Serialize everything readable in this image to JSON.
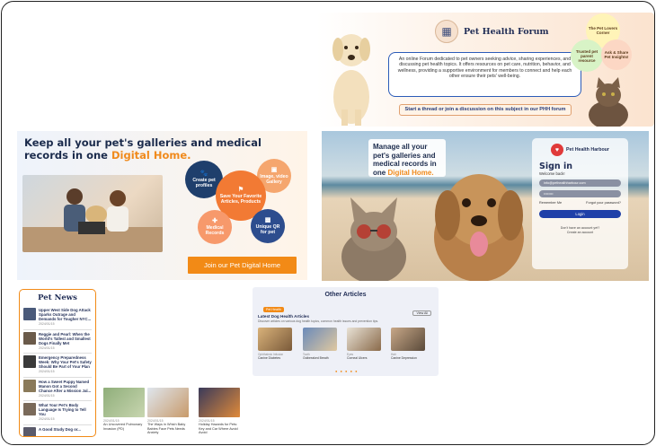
{
  "forum": {
    "title": "Pet Health Forum",
    "description": "An online Forum dedicated to pet owners seeking advice, sharing experiences, and discussing pet health topics. It offers resources on pet care, nutrition, behavior, and wellness, providing a supportive environment for members to connect and help each other ensure their pets' well-being.",
    "cta": "Start a thread or join a discussion on this subject in our PHH forum",
    "bubbles": [
      "The Pet Lovers Corner",
      "Trusted pet parent resource",
      "Ask & Share Pet Insights!"
    ]
  },
  "home": {
    "headline_a": "Keep all your pet's galleries and medical records in one ",
    "headline_b": "Digital Home.",
    "circles": {
      "create": "Create pet profiles",
      "images": "Image, video Gallery",
      "save": "Save Your Favorite Articles, Products",
      "medical": "Medical Records",
      "qr": "Unique QR for pet"
    },
    "button": "Join our Pet Digital Home"
  },
  "beach": {
    "pane_a": "Manage all your pet's galleries and medical records in one ",
    "pane_b": "Digital Home.",
    "login": {
      "brand": "Pet Health Harbour",
      "title": "Sign in",
      "welcome": "Welcome back!",
      "email": "info@pethealthharbour.com",
      "password": "••••••••",
      "remember": "Remember Me",
      "forgot": "Forgot your password?",
      "button": "Login",
      "note_a": "Don't have an account yet?",
      "note_b": "Create an account"
    }
  },
  "news": {
    "title": "Pet News",
    "items": [
      {
        "title": "Upper West Side Dog Attack Sparks Outrage and Demands for Tougher NYC...",
        "date": "2024/01/15"
      },
      {
        "title": "Reggie and Pearl: When the World's Tallest and Smallest Dogs Finally Met",
        "date": "2024/01/15"
      },
      {
        "title": "Emergency Preparedness Week: Why Your Pet's Safety Should Be Part of Your Plan",
        "date": "2024/01/15"
      },
      {
        "title": "How a Sweet Puppy Named Manon Got a Second Chance After a Mission Jal...",
        "date": "2024/01/15"
      },
      {
        "title": "What Your Pet's Body Language Is Trying to Tell You",
        "date": "2024/01/15"
      },
      {
        "title": "A Good Study Dog or...",
        "date": ""
      }
    ]
  },
  "cards": [
    {
      "date": "2024/01/15",
      "title": "An Uncovered Pulmonary Invasion (PD)"
    },
    {
      "date": "2024/01/15",
      "title": "The Ways in Which Baby Babies Face Pets Needs Anxiety"
    },
    {
      "date": "2024/01/15",
      "title": "Holiday Hazards for Pets: Key and Car Where Avoid Avoid"
    }
  ],
  "other": {
    "title": "Other Articles",
    "tag": "Pet Health",
    "view_all": "View All",
    "latest": "Latest Dog Health Articles",
    "latest_desc": "Discover articles on various dog health topics, common health issues and prevention tips.",
    "articles": [
      {
        "kind": "Ophthalmic Infusion",
        "name": "Canine Diabetes"
      },
      {
        "kind": "Tooth",
        "name": "Outbreaked Breath"
      },
      {
        "kind": "Eyes",
        "name": "Corneal Ulcers"
      },
      {
        "kind": "Hair",
        "name": "Canine Depression"
      }
    ]
  },
  "colors": {
    "accent": "#f28a16",
    "navy": "#1f2c55",
    "login_blue": "#1f40a8"
  }
}
